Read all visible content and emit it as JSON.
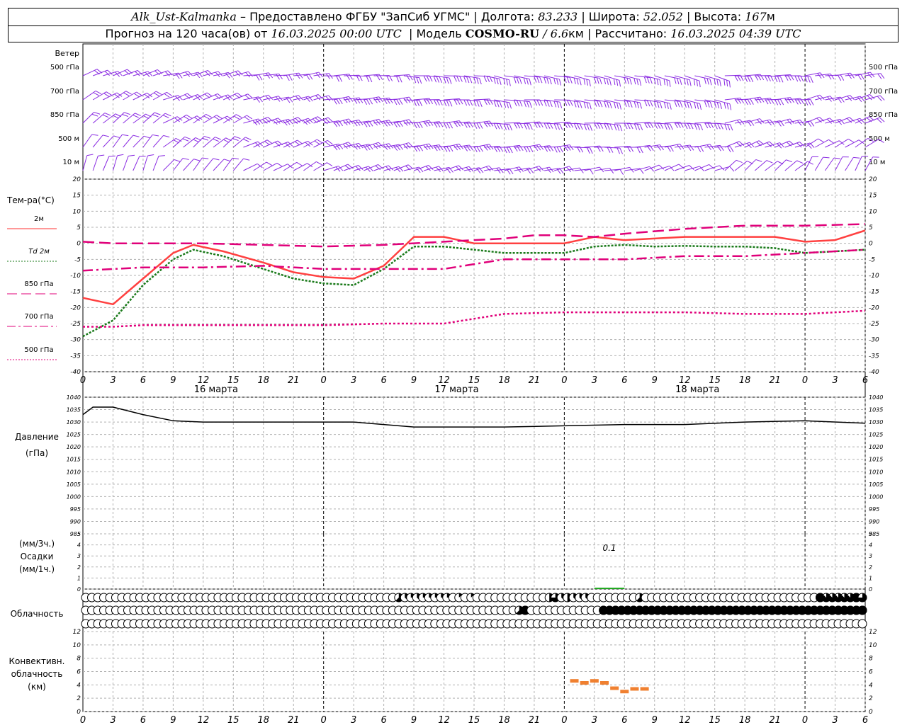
{
  "header": {
    "station": "Alk_Ust-Kalmanka",
    "dash": "–",
    "provider": "Предоставлено ФГБУ \"ЗапСиб УГМС\"",
    "sep": "|",
    "lon_label": "Долгота:",
    "lon": "83.233",
    "lat_label": "Широта:",
    "lat": "52.052",
    "alt_label": "Высота:",
    "alt": "167",
    "alt_unit": "м",
    "forecast_label": "Прогноз на 120 часа(ов) от",
    "forecast_start": "16.03.2025 00:00 UTC",
    "model_label": "Модель",
    "model": "COSMO-RU",
    "slash": "/",
    "resolution": "6.6",
    "res_unit": "км",
    "computed_label": "Рассчитано:",
    "computed": "16.03.2025 04:39 UTC"
  },
  "wind_panel": {
    "title": "Ветер",
    "levels": [
      "500 гПа",
      "700 гПа",
      "850 гПа",
      "500 м",
      "10  м"
    ],
    "color": "#8a2be2"
  },
  "temp_panel": {
    "title": "Тем-ра(°С)",
    "legend": [
      {
        "label": "2м",
        "color": "#ff3030",
        "style": "solid"
      },
      {
        "label": "Td  2м",
        "color": "#1a7a1a",
        "style": "dotted"
      },
      {
        "label": "850 гПа",
        "color": "#e0007a",
        "style": "longdash"
      },
      {
        "label": "700 гПа",
        "color": "#e0007a",
        "style": "dashdot"
      },
      {
        "label": "500 гПа",
        "color": "#e0007a",
        "style": "dotted"
      }
    ],
    "yticks": [
      20,
      15,
      10,
      5,
      0,
      -5,
      -10,
      -15,
      -20,
      -25,
      -30,
      -35,
      -40
    ]
  },
  "pressure_panel": {
    "title": "Давление",
    "unit": "(гПа)",
    "yticks": [
      1040,
      1035,
      1030,
      1025,
      1020,
      1015,
      1010,
      1005,
      1000,
      995,
      990,
      985
    ]
  },
  "precip_panel": {
    "unit_top": "(мм/3ч.)",
    "title": "Осадки",
    "unit_bottom": "(мм/1ч.)",
    "yticks": [
      5,
      4,
      3,
      2,
      1,
      0
    ],
    "annotation": "0.1",
    "bar": {
      "start_h": 51,
      "end_h": 54,
      "color": "#22aa22"
    }
  },
  "cloud_panel": {
    "title": "Облачность",
    "layers": [
      "high",
      "mid",
      "low"
    ]
  },
  "conv_panel": {
    "title_lines": [
      "Конвективн.",
      "облачность",
      "(км)"
    ],
    "yticks": [
      12,
      10,
      8,
      6,
      4,
      2,
      0
    ],
    "color": "#f08030"
  },
  "time_axis": {
    "tick_labels": [
      "0",
      "3",
      "6",
      "9",
      "12",
      "15",
      "18",
      "21",
      "0",
      "3",
      "6",
      "9",
      "12",
      "15",
      "18",
      "21",
      "0",
      "3",
      "6",
      "9",
      "12",
      "15",
      "18",
      "21",
      "0",
      "3",
      "6"
    ],
    "day_labels": [
      {
        "label": "16 марта",
        "hour": 12
      },
      {
        "label": "17 марта",
        "hour": 36
      },
      {
        "label": "18 марта",
        "hour": 60
      }
    ]
  },
  "chart_data": {
    "type": "line",
    "x_unit": "hours since 16.03.2025 00:00 UTC",
    "x_range": [
      0,
      78
    ],
    "series": [
      {
        "name": "2м",
        "x": [
          0,
          3,
          6,
          9,
          11,
          14,
          18,
          21,
          24,
          27,
          30,
          33,
          36,
          39,
          42,
          45,
          48,
          51,
          54,
          57,
          60,
          63,
          66,
          69,
          72,
          75,
          78
        ],
        "y": [
          -17,
          -19,
          -11,
          -3,
          -0.5,
          -2.5,
          -6,
          -9,
          -10.5,
          -11,
          -7,
          2,
          2,
          0,
          0,
          0,
          0,
          2,
          1,
          1.5,
          2,
          2,
          2,
          2,
          0.5,
          1,
          4
        ]
      },
      {
        "name": "Td  2м",
        "x": [
          0,
          3,
          6,
          9,
          11,
          14,
          18,
          21,
          24,
          27,
          30,
          33,
          36,
          39,
          42,
          45,
          48,
          51,
          54,
          57,
          60,
          63,
          66,
          69,
          72,
          75,
          78
        ],
        "y": [
          -29,
          -24,
          -13,
          -5,
          -2,
          -4,
          -8,
          -11,
          -12.5,
          -13,
          -8,
          -1,
          -1,
          -2,
          -3,
          -3,
          -3,
          -1,
          -0.5,
          -1,
          -0.8,
          -1,
          -1,
          -1.5,
          -3,
          -2.5,
          -2
        ]
      },
      {
        "name": "850 гПа",
        "x": [
          0,
          3,
          6,
          12,
          18,
          24,
          30,
          36,
          42,
          45,
          48,
          51,
          54,
          60,
          66,
          72,
          78
        ],
        "y": [
          0.5,
          0,
          0,
          0,
          -0.5,
          -1,
          -0.5,
          0.5,
          1.5,
          2.5,
          2.5,
          2,
          3,
          4.5,
          5.5,
          5.5,
          6
        ]
      },
      {
        "name": "700 гПа",
        "x": [
          0,
          6,
          12,
          18,
          24,
          30,
          36,
          42,
          48,
          54,
          60,
          66,
          72,
          78
        ],
        "y": [
          -8.5,
          -7.5,
          -7.5,
          -7,
          -8,
          -8,
          -8,
          -5,
          -5,
          -5,
          -4,
          -4,
          -3,
          -2
        ]
      },
      {
        "name": "500 гПа",
        "x": [
          0,
          3,
          6,
          12,
          18,
          24,
          30,
          36,
          42,
          48,
          54,
          60,
          66,
          72,
          78
        ],
        "y": [
          -26,
          -26,
          -25.5,
          -25.5,
          -25.5,
          -25.5,
          -25,
          -25,
          -22,
          -21.5,
          -21.5,
          -21.5,
          -22,
          -22,
          -21
        ]
      },
      {
        "name": "Давление",
        "x": [
          0,
          1,
          3,
          6,
          9,
          12,
          15,
          18,
          21,
          24,
          27,
          30,
          33,
          36,
          42,
          48,
          54,
          60,
          66,
          72,
          78
        ],
        "y": [
          1033,
          1036,
          1036,
          1033,
          1030.5,
          1030,
          1030,
          1030,
          1030,
          1030,
          1030,
          1029,
          1028,
          1028,
          1028,
          1028.5,
          1029,
          1029,
          1030,
          1030.5,
          1029.5
        ]
      },
      {
        "name": "Конвективн. облачность",
        "x": [
          49,
          50,
          51,
          52,
          53,
          54,
          55,
          56
        ],
        "y": [
          4.6,
          4.3,
          4.6,
          4.3,
          3.5,
          3.0,
          3.4,
          3.4
        ]
      }
    ],
    "cloud_cover_octas": {
      "high": "0000000000000000000000000000000000000000000000000000532322222010100000000000046343330000000050000000000000000000000000000087777786",
      "mid": "0000000000000000000000000000000000000000000000000000000000000000000000005800000000000088888888888888888888888888888888888888888888",
      "low": "0000000000000000000000000000000000000000000000000000000000000000000000000000000000000000000000000000000000000000000000000000000000"
    }
  }
}
